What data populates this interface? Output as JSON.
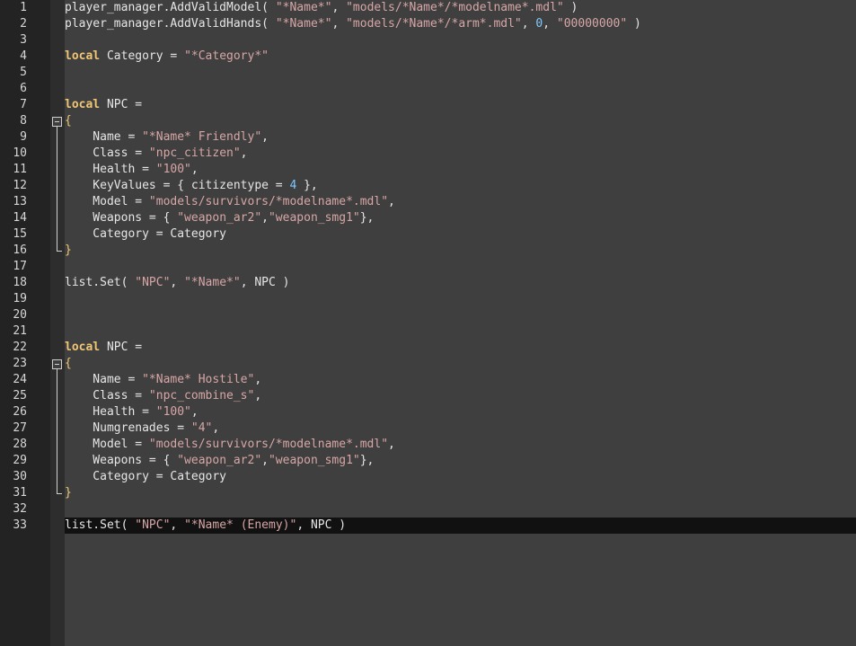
{
  "editor": {
    "line_numbers": [
      "1",
      "2",
      "3",
      "4",
      "5",
      "6",
      "7",
      "8",
      "9",
      "10",
      "11",
      "12",
      "13",
      "14",
      "15",
      "16",
      "17",
      "18",
      "19",
      "20",
      "21",
      "22",
      "23",
      "24",
      "25",
      "26",
      "27",
      "28",
      "29",
      "30",
      "31",
      "32",
      "33"
    ],
    "lines": [
      [
        {
          "t": "id",
          "v": "player_manager.AddValidModel( "
        },
        {
          "t": "str",
          "v": "\"*Name*\""
        },
        {
          "t": "id",
          "v": ", "
        },
        {
          "t": "str",
          "v": "\"models/*Name*/*modelname*.mdl\""
        },
        {
          "t": "id",
          "v": " )"
        }
      ],
      [
        {
          "t": "id",
          "v": "player_manager.AddValidHands( "
        },
        {
          "t": "str",
          "v": "\"*Name*\""
        },
        {
          "t": "id",
          "v": ", "
        },
        {
          "t": "str",
          "v": "\"models/*Name*/*arm*.mdl\""
        },
        {
          "t": "id",
          "v": ", "
        },
        {
          "t": "num",
          "v": "0"
        },
        {
          "t": "id",
          "v": ", "
        },
        {
          "t": "str",
          "v": "\"00000000\""
        },
        {
          "t": "id",
          "v": " )"
        }
      ],
      [],
      [
        {
          "t": "kw",
          "v": "local"
        },
        {
          "t": "id",
          "v": " Category = "
        },
        {
          "t": "str",
          "v": "\"*Category*\""
        }
      ],
      [],
      [],
      [
        {
          "t": "kw",
          "v": "local"
        },
        {
          "t": "id",
          "v": " NPC ="
        }
      ],
      [
        {
          "t": "brace",
          "v": "{"
        }
      ],
      [
        {
          "t": "id",
          "v": "    Name = "
        },
        {
          "t": "str",
          "v": "\"*Name* Friendly\""
        },
        {
          "t": "id",
          "v": ","
        }
      ],
      [
        {
          "t": "id",
          "v": "    Class = "
        },
        {
          "t": "str",
          "v": "\"npc_citizen\""
        },
        {
          "t": "id",
          "v": ","
        }
      ],
      [
        {
          "t": "id",
          "v": "    Health = "
        },
        {
          "t": "str",
          "v": "\"100\""
        },
        {
          "t": "id",
          "v": ","
        }
      ],
      [
        {
          "t": "id",
          "v": "    KeyValues = { citizentype = "
        },
        {
          "t": "num",
          "v": "4"
        },
        {
          "t": "id",
          "v": " },"
        }
      ],
      [
        {
          "t": "id",
          "v": "    Model = "
        },
        {
          "t": "str",
          "v": "\"models/survivors/*modelname*.mdl\""
        },
        {
          "t": "id",
          "v": ","
        }
      ],
      [
        {
          "t": "id",
          "v": "    Weapons = { "
        },
        {
          "t": "str",
          "v": "\"weapon_ar2\""
        },
        {
          "t": "id",
          "v": ","
        },
        {
          "t": "str",
          "v": "\"weapon_smg1\""
        },
        {
          "t": "id",
          "v": "},"
        }
      ],
      [
        {
          "t": "id",
          "v": "    Category = Category"
        }
      ],
      [
        {
          "t": "brace",
          "v": "}"
        }
      ],
      [],
      [
        {
          "t": "id",
          "v": "list.Set( "
        },
        {
          "t": "str",
          "v": "\"NPC\""
        },
        {
          "t": "id",
          "v": ", "
        },
        {
          "t": "str",
          "v": "\"*Name*\""
        },
        {
          "t": "id",
          "v": ", NPC )"
        }
      ],
      [],
      [],
      [],
      [
        {
          "t": "kw",
          "v": "local"
        },
        {
          "t": "id",
          "v": " NPC ="
        }
      ],
      [
        {
          "t": "brace",
          "v": "{"
        }
      ],
      [
        {
          "t": "id",
          "v": "    Name = "
        },
        {
          "t": "str",
          "v": "\"*Name* Hostile\""
        },
        {
          "t": "id",
          "v": ","
        }
      ],
      [
        {
          "t": "id",
          "v": "    Class = "
        },
        {
          "t": "str",
          "v": "\"npc_combine_s\""
        },
        {
          "t": "id",
          "v": ","
        }
      ],
      [
        {
          "t": "id",
          "v": "    Health = "
        },
        {
          "t": "str",
          "v": "\"100\""
        },
        {
          "t": "id",
          "v": ","
        }
      ],
      [
        {
          "t": "id",
          "v": "    Numgrenades = "
        },
        {
          "t": "str",
          "v": "\"4\""
        },
        {
          "t": "id",
          "v": ","
        }
      ],
      [
        {
          "t": "id",
          "v": "    Model = "
        },
        {
          "t": "str",
          "v": "\"models/survivors/*modelname*.mdl\""
        },
        {
          "t": "id",
          "v": ","
        }
      ],
      [
        {
          "t": "id",
          "v": "    Weapons = { "
        },
        {
          "t": "str",
          "v": "\"weapon_ar2\""
        },
        {
          "t": "id",
          "v": ","
        },
        {
          "t": "str",
          "v": "\"weapon_smg1\""
        },
        {
          "t": "id",
          "v": "},"
        }
      ],
      [
        {
          "t": "id",
          "v": "    Category = Category"
        }
      ],
      [
        {
          "t": "brace",
          "v": "}"
        }
      ],
      [],
      [
        {
          "t": "id",
          "v": "list.Set( "
        },
        {
          "t": "str",
          "v": "\"NPC\""
        },
        {
          "t": "id",
          "v": ", "
        },
        {
          "t": "str",
          "v": "\"*Name* (Enemy)\""
        },
        {
          "t": "id",
          "v": ", NPC )"
        }
      ]
    ],
    "current_line": "33",
    "colors": {
      "background": "#3f3f3f",
      "gutter": "#232323",
      "keyword": "#f0c674",
      "string": "#d7a6a6",
      "number": "#7ec8ff",
      "text": "#e6e6e6"
    }
  }
}
